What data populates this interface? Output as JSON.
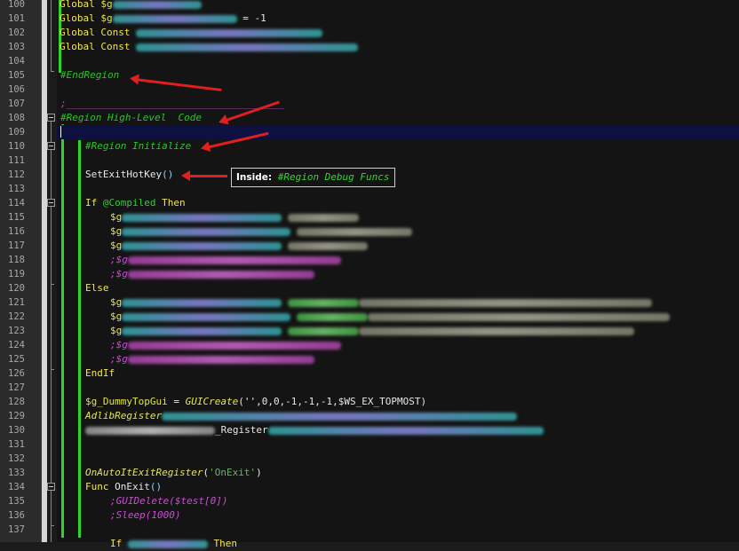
{
  "editor": {
    "line_numbers": [
      "100",
      "101",
      "102",
      "103",
      "104",
      "105",
      "106",
      "107",
      "108",
      "109",
      "110",
      "111",
      "112",
      "113",
      "114",
      "115",
      "116",
      "117",
      "118",
      "119",
      "120",
      "121",
      "122",
      "123",
      "124",
      "125",
      "126",
      "127",
      "128",
      "129",
      "130",
      "131",
      "132",
      "133",
      "134",
      "135",
      "136",
      "137"
    ],
    "code": {
      "l100_kw": "Global",
      "l100_var": "$g",
      "l101_kw": "Global",
      "l101_var": "$g",
      "l101_op": " = -1",
      "l102_kw": "Global Const",
      "l103_kw": "Global Const",
      "l105_comment": "#EndRegion",
      "l107_comment": ";_____________________________________",
      "l108_comment": "#Region High-Level  Code",
      "l110_comment": "#Region Initialize",
      "l112_text": "SetExitHotKey",
      "l112_paren": "()",
      "l114_kw": "If",
      "l114_macro": "@Compiled",
      "l114_then": "Then",
      "l115_var": "$g",
      "l116_var": "$g",
      "l117_var": "$g",
      "l118_comment": ";$g",
      "l119_comment": ";$g",
      "l120_kw": "Else",
      "l121_var": "$g",
      "l122_var": "$g",
      "l123_var": "$g",
      "l124_comment": ";$g",
      "l125_comment": ";$g",
      "l126_kw": "EndIf",
      "l128_var": "$g_DummyTopGui",
      "l128_eq": " = ",
      "l128_func": "GUICreate",
      "l128_args": "('',0,0,-1,-1,-1,$WS_EX_TOPMOST)",
      "l129_func": "AdlibRegister",
      "l130_text": "_Register",
      "l133_func": "OnAutoItExitRegister",
      "l133_args_open": "(",
      "l133_str": "'OnExit'",
      "l133_args_close": ")",
      "l134_kw": "Func",
      "l134_name": "OnExit",
      "l134_paren": "()",
      "l135_comment": ";GUIDelete($test[0])",
      "l136_comment": ";Sleep(1000)",
      "l137_kw": "If",
      "l137_then": "Then"
    },
    "current_line": "109"
  },
  "tooltip": {
    "label": "Inside:",
    "value": "#Region Debug Funcs"
  },
  "colors": {
    "keyword": "#f5e64a",
    "comment": "#2cc42c",
    "commented_code": "#c94fd0",
    "region_bar": "#2bd52b",
    "annotation_arrow": "#e02020",
    "current_line_bg": "#0d1040"
  }
}
